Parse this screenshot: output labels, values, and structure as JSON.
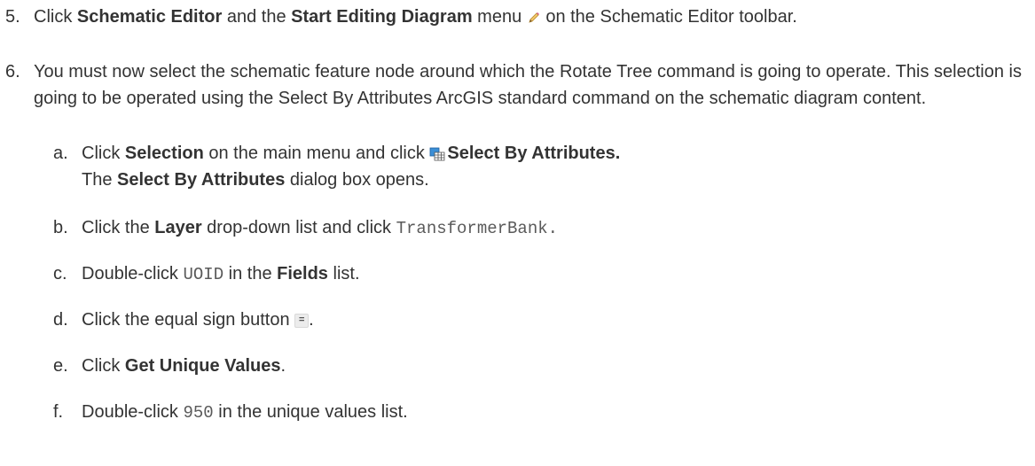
{
  "steps": [
    {
      "num": "5.",
      "p1": "Click ",
      "b1": "Schematic Editor",
      "p2": " and the ",
      "b2": "Start Editing Diagram",
      "p3": " menu ",
      "p4": " on the Schematic Editor toolbar.",
      "icon": "pencil-icon"
    },
    {
      "num": "6.",
      "text": "You must now select the schematic feature node around which the Rotate Tree command is going to operate. This selection is going to be operated using the Select By Attributes ArcGIS standard command on the schematic diagram content.",
      "substeps": [
        {
          "letter": "a.",
          "p1": "Click ",
          "b1": "Selection",
          "p2": " on the main menu and click ",
          "b2": "Select By Attributes.",
          "line2_p1": "The ",
          "line2_b1": "Select By Attributes",
          "line2_p2": " dialog box opens.",
          "icon": "select-by-attributes-icon"
        },
        {
          "letter": "b.",
          "p1": "Click the ",
          "b1": "Layer",
          "p2": " drop-down list and click ",
          "code": "TransformerBank."
        },
        {
          "letter": "c.",
          "p1": "Double-click ",
          "code": "UOID",
          "p2": " in the ",
          "b1": "Fields",
          "p3": " list."
        },
        {
          "letter": "d.",
          "p1": "Click the equal sign button ",
          "button_label": "=",
          "p2": ".",
          "icon": "equal-sign-button"
        },
        {
          "letter": "e.",
          "p1": "Click ",
          "b1": "Get Unique Values",
          "p2": "."
        },
        {
          "letter": "f.",
          "p1": "Double-click ",
          "code": "950",
          "p2": " in the unique values list."
        }
      ]
    }
  ]
}
